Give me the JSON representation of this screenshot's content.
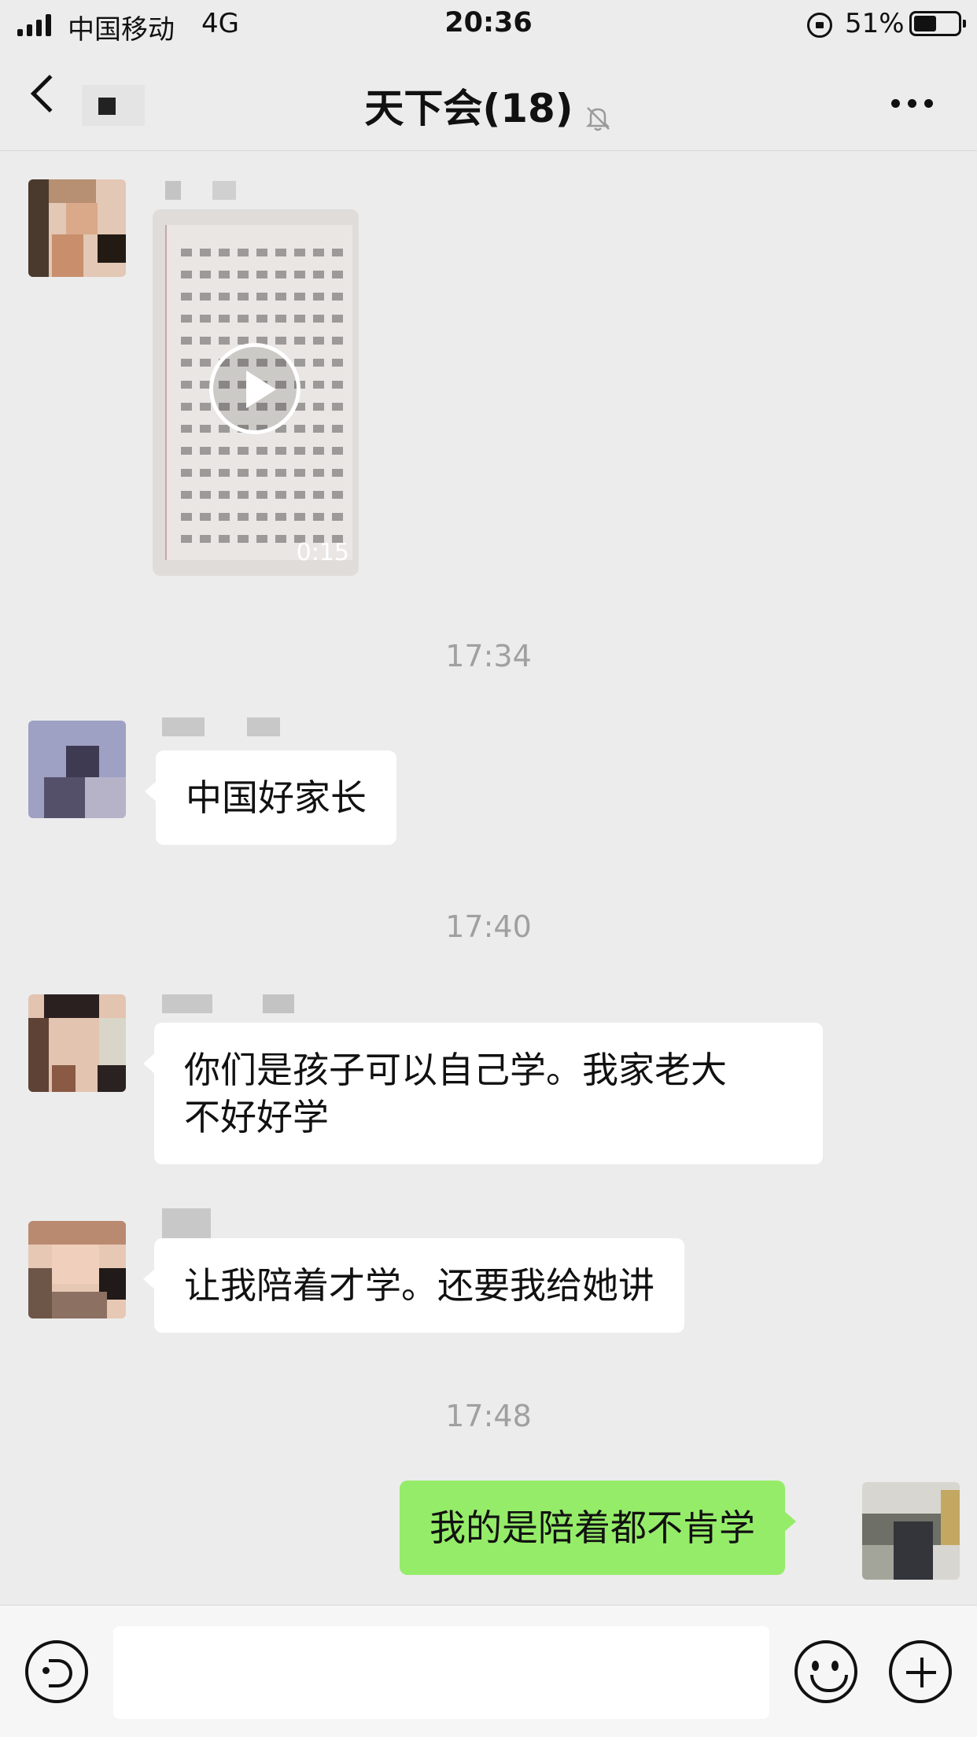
{
  "status_bar": {
    "carrier": "中国移动",
    "network": "4G",
    "time": "20:36",
    "battery_percent": "51%",
    "battery_level": 0.51
  },
  "nav": {
    "back_icon": "chevron-left-icon",
    "title": "天下会(18)",
    "mute_icon": "bell-muted-icon",
    "more_icon": "more-dots-icon"
  },
  "messages": {
    "video": {
      "duration": "0:15",
      "play_icon": "play-icon"
    },
    "ts1": "17:34",
    "m1": "中国好家长",
    "ts2": "17:40",
    "m2_line1": "你们是孩子可以自己学。我家老大",
    "m2_line2": "不好好学",
    "m3": "让我陪着才学。还要我给她讲",
    "ts3": "17:48",
    "m4": "我的是陪着都不肯学"
  },
  "input_bar": {
    "voice_icon": "voice-icon",
    "emoji_icon": "emoji-icon",
    "plus_icon": "plus-icon"
  },
  "colors": {
    "background": "#ececec",
    "bubble_in": "#ffffff",
    "bubble_out": "#95ec69",
    "timestamp": "#a0a0a0"
  }
}
